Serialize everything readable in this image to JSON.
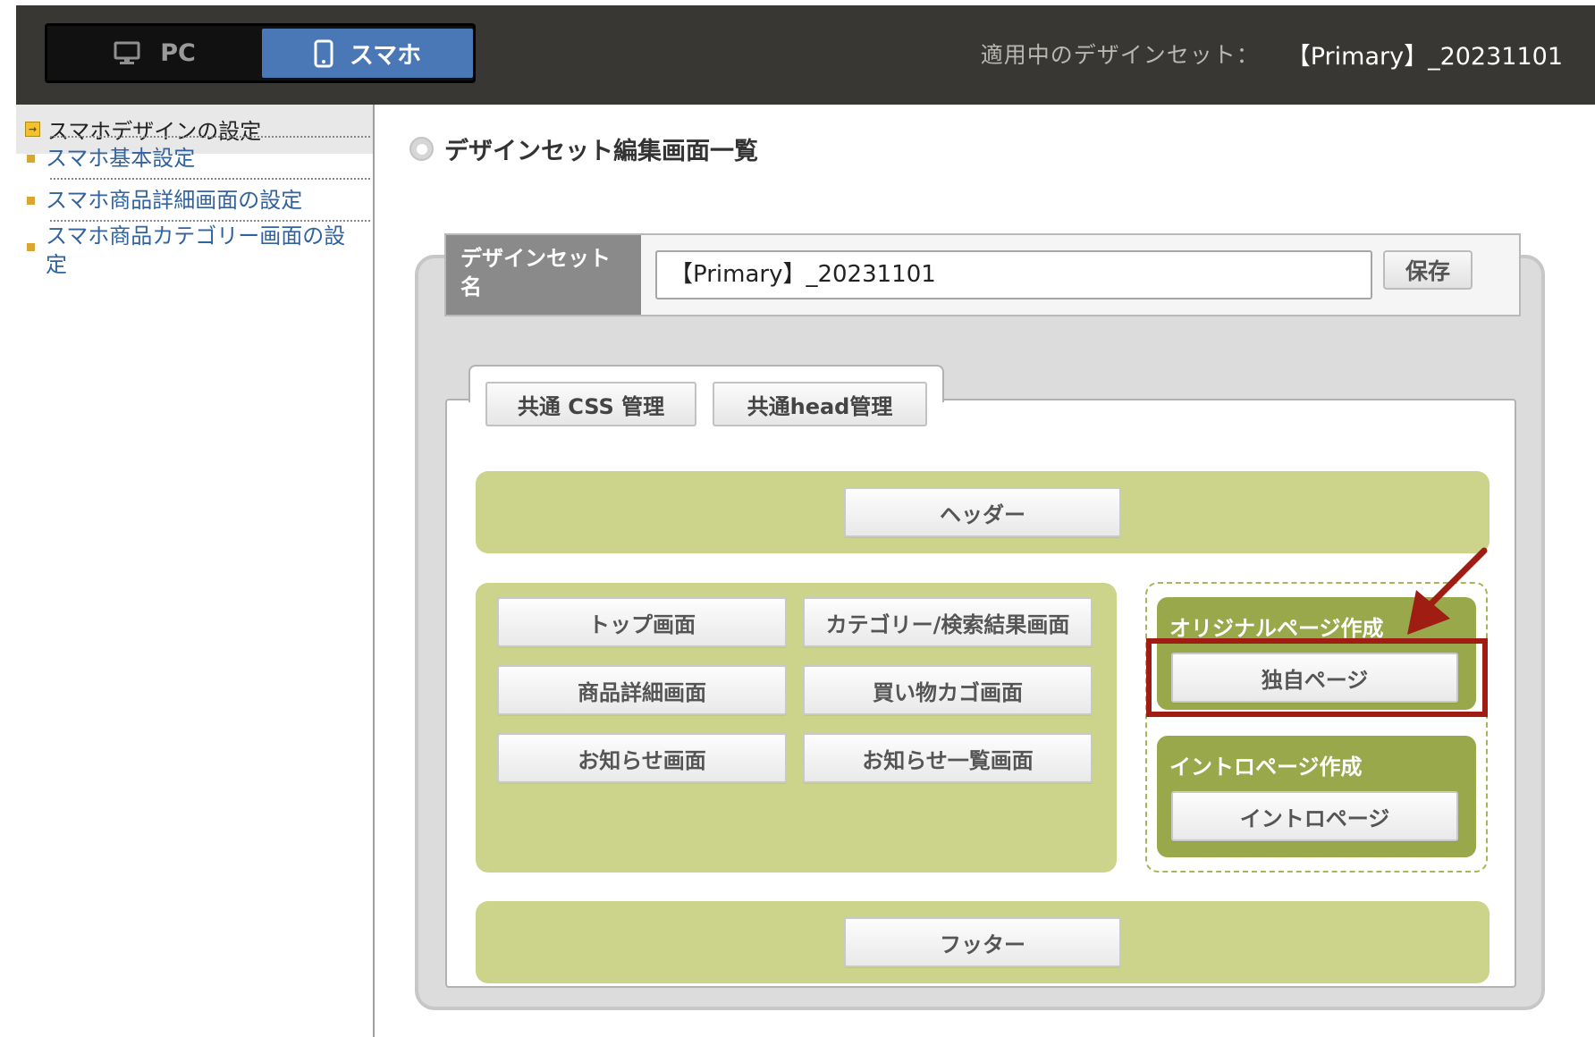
{
  "device_switch": {
    "pc_label": "PC",
    "smartphone_label": "スマホ",
    "selected": "スマホ"
  },
  "applied_set": {
    "label": "適用中のデザインセット：",
    "value": "【Primary】_20231101"
  },
  "sidebar": {
    "heading": "スマホデザインの設定",
    "items": [
      {
        "label": "スマホ基本設定"
      },
      {
        "label": "スマホ商品詳細画面の設定"
      },
      {
        "label_line1": "スマホ商品カテゴリー画面の設",
        "label_line2": "定"
      }
    ]
  },
  "main": {
    "title": "デザインセット編集画面一覧",
    "name_label_line1": "デザインセット",
    "name_label_line2": "名",
    "name_value": "【Primary】_20231101",
    "save_label": "保存",
    "tabs": [
      {
        "label": "共通 CSS 管理"
      },
      {
        "label": "共通head管理"
      }
    ],
    "header_button": "ヘッダー",
    "footer_button": "フッター",
    "page_buttons": [
      "トップ画面",
      "カテゴリー/検索結果画面",
      "商品詳細画面",
      "買い物カゴ画面",
      "お知らせ画面",
      "お知らせ一覧画面"
    ],
    "original_section": {
      "title": "オリジナルページ作成",
      "button": "独自ページ"
    },
    "intro_section": {
      "title": "イントロページ作成",
      "button": "イントロページ"
    }
  },
  "colors": {
    "topbar": "#393734",
    "selected_device": "#4a78b6",
    "section_green": "#cbd48a",
    "section_olive": "#98a84a",
    "highlight_red": "#a01d14",
    "link_blue": "#3263a0"
  }
}
